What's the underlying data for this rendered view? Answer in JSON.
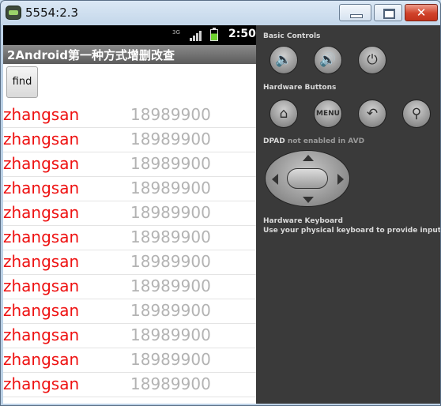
{
  "window": {
    "title": "5554:2.3",
    "close_label": "✕"
  },
  "statusbar": {
    "network": "3G",
    "time": "2:50"
  },
  "app": {
    "title": "2Android第一种方式增删改查",
    "find_label": "find"
  },
  "contacts": [
    {
      "name": "zhangsan",
      "phone": "18989900"
    },
    {
      "name": "zhangsan",
      "phone": "18989900"
    },
    {
      "name": "zhangsan",
      "phone": "18989900"
    },
    {
      "name": "zhangsan",
      "phone": "18989900"
    },
    {
      "name": "zhangsan",
      "phone": "18989900"
    },
    {
      "name": "zhangsan",
      "phone": "18989900"
    },
    {
      "name": "zhangsan",
      "phone": "18989900"
    },
    {
      "name": "zhangsan",
      "phone": "18989900"
    },
    {
      "name": "zhangsan",
      "phone": "18989900"
    },
    {
      "name": "zhangsan",
      "phone": "18989900"
    },
    {
      "name": "zhangsan",
      "phone": "18989900"
    },
    {
      "name": "zhangsan",
      "phone": "18989900"
    }
  ],
  "panel": {
    "basic_controls": "Basic Controls",
    "hardware_buttons": "Hardware Buttons",
    "menu_label": "MENU",
    "dpad_label": "DPAD",
    "dpad_note": "not enabled in AVD",
    "keyboard_title": "Hardware Keyboard",
    "keyboard_note": "Use your physical keyboard to provide input"
  },
  "colors": {
    "contact_name": "#ee1111",
    "contact_phone": "#b3b3b3",
    "panel_bg": "#3a3a3a"
  }
}
